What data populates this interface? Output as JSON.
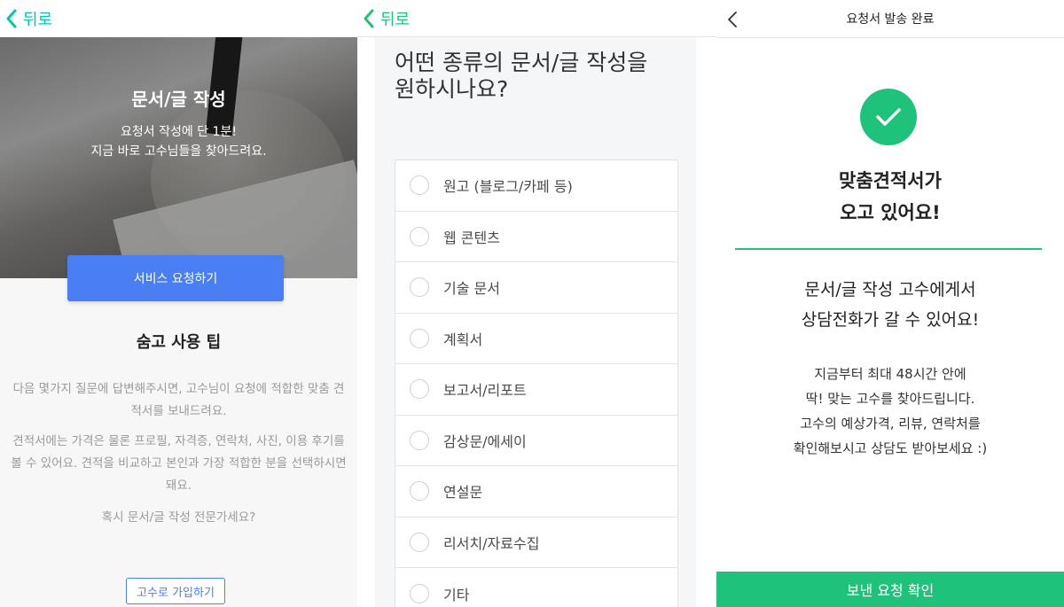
{
  "panel1": {
    "back_label": "뒤로",
    "hero": {
      "title": "문서/글 작성",
      "subtitle_line1": "요청서 작성에 단 1분!",
      "subtitle_line2": "지금 바로 고수님들을 찾아드려요."
    },
    "request_button": "서비스 요청하기",
    "tips": {
      "title": "숨고 사용 팁",
      "paragraph1": "다음 몇가지 질문에 답변해주시면, 고수님이 요청에 적합한 맞춤 견적서를 보내드려요.",
      "paragraph2": "견적서에는 가격은 물론 프로필, 자격증, 연락처, 사진, 이용 후기를 볼 수 있어요. 견적을 비교하고 본인과 가장 적합한 분을 선택하시면 돼요.",
      "paragraph3": "혹시 문서/글 작성 전문가세요?"
    },
    "join_button": "고수로 가입하기",
    "accent_color": "#4a7ef3"
  },
  "panel2": {
    "back_label": "뒤로",
    "question_line1": "어떤 종류의 문서/글 작성을",
    "question_line2": "원하시나요?",
    "options": [
      "원고 (블로그/카페 등)",
      "웹 콘텐츠",
      "기술 문서",
      "계획서",
      "보고서/리포트",
      "감상문/에세이",
      "연설문",
      "리서치/자료수집",
      "기타"
    ]
  },
  "panel3": {
    "header_title": "요청서 발송 완료",
    "done_title_line1": "맞춤견적서가",
    "done_title_line2": "오고 있어요!",
    "sub_line1": "문서/글 작성 고수에게서",
    "sub_line2": "상담전화가 갈 수 있어요!",
    "desc_line1": "지금부터 최대 48시간 안에",
    "desc_line2": "딱! 맞는 고수를 찾아드립니다.",
    "desc_line3": "고수의 예상가격, 리뷰, 연락처를",
    "desc_line4": "확인해보시고 상담도 받아보세요 :)",
    "confirm_button": "보낸 요청 확인",
    "accent_color": "#1fc27a",
    "icons": [
      "chevron-left-icon",
      "check-icon"
    ]
  }
}
